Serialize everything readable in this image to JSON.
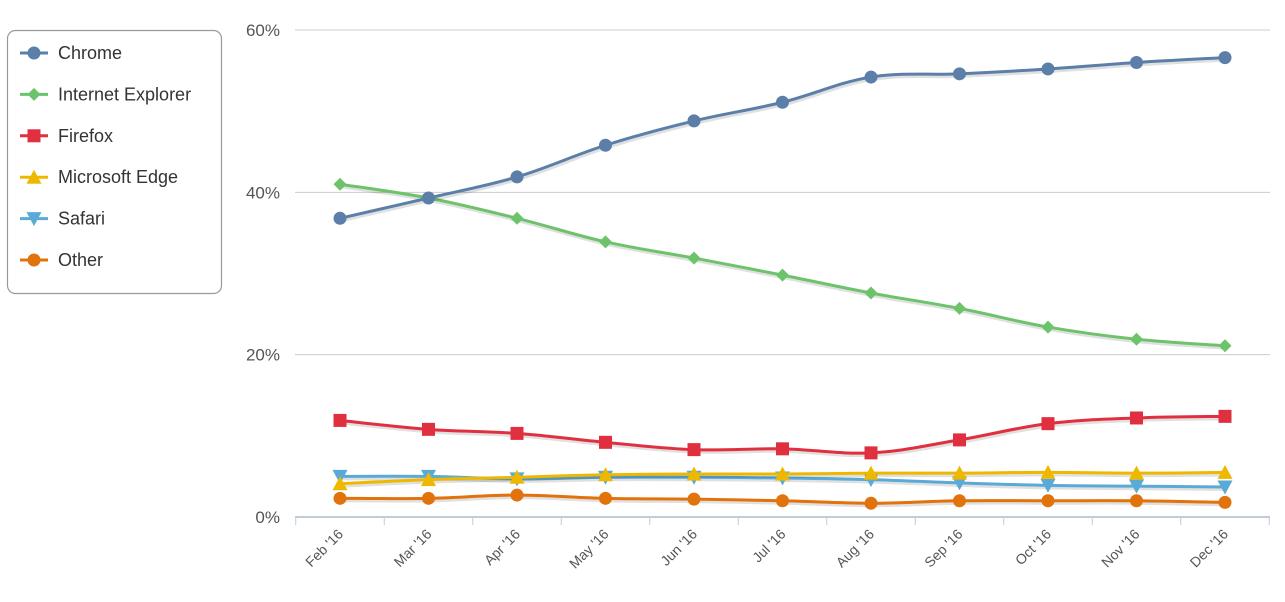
{
  "chart_data": {
    "type": "line",
    "title": "",
    "xlabel": "",
    "ylabel": "",
    "categories": [
      "Feb '16",
      "Mar '16",
      "Apr '16",
      "May '16",
      "Jun '16",
      "Jul '16",
      "Aug '16",
      "Sep '16",
      "Oct '16",
      "Nov '16",
      "Dec '16"
    ],
    "ylim": [
      0,
      60
    ],
    "yticks": [
      0,
      20,
      40,
      60
    ],
    "ytick_labels": [
      "0%",
      "20%",
      "40%",
      "60%"
    ],
    "grid": true,
    "legend_position": "top-left",
    "series": [
      {
        "name": "Chrome",
        "color": "#5b7fa8",
        "marker": "circle",
        "values": [
          36.8,
          39.3,
          41.9,
          45.8,
          48.8,
          51.1,
          54.2,
          54.6,
          55.2,
          56.0,
          56.6
        ]
      },
      {
        "name": "Internet Explorer",
        "color": "#6cc36a",
        "marker": "diamond",
        "values": [
          41.0,
          39.3,
          36.8,
          33.9,
          31.9,
          29.8,
          27.6,
          25.7,
          23.4,
          21.9,
          21.1
        ]
      },
      {
        "name": "Firefox",
        "color": "#e03040",
        "marker": "square",
        "values": [
          11.9,
          10.8,
          10.3,
          9.2,
          8.3,
          8.4,
          7.9,
          9.5,
          11.5,
          12.2,
          12.4
        ]
      },
      {
        "name": "Microsoft Edge",
        "color": "#efb800",
        "marker": "triangle",
        "values": [
          4.1,
          4.6,
          4.9,
          5.2,
          5.3,
          5.3,
          5.4,
          5.4,
          5.5,
          5.4,
          5.5
        ]
      },
      {
        "name": "Safari",
        "color": "#5aaad8",
        "marker": "triangle-down",
        "values": [
          5.0,
          5.0,
          4.7,
          4.9,
          4.9,
          4.8,
          4.6,
          4.2,
          3.9,
          3.8,
          3.7
        ]
      },
      {
        "name": "Other",
        "color": "#e2720c",
        "marker": "circle",
        "values": [
          2.3,
          2.3,
          2.7,
          2.3,
          2.2,
          2.0,
          1.7,
          2.0,
          2.0,
          2.0,
          1.8
        ]
      }
    ]
  }
}
